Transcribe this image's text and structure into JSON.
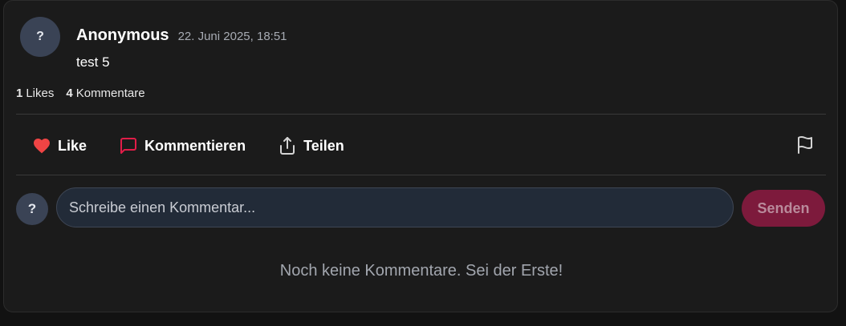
{
  "post": {
    "avatar_initial": "?",
    "author": "Anonymous",
    "timestamp": "22. Juni 2025, 18:51",
    "text": "test 5"
  },
  "stats": {
    "likes_count": "1",
    "likes_label": "Likes",
    "comments_count": "4",
    "comments_label": "Kommentare"
  },
  "actions": {
    "like_label": "Like",
    "comment_label": "Kommentieren",
    "share_label": "Teilen",
    "icons": [
      "heart-icon",
      "comment-icon",
      "share-icon",
      "flag-icon"
    ]
  },
  "composer": {
    "avatar_initial": "?",
    "placeholder": "Schreibe einen Kommentar...",
    "value": "",
    "send_label": "Senden"
  },
  "comments": {
    "empty_message": "Noch keine Kommentare. Sei der Erste!"
  },
  "colors": {
    "background": "#121212",
    "card": "#1b1b1b",
    "accent": "#e11d48",
    "heart": "#ef4444",
    "send_button_disabled": "#7d1a3c",
    "avatar": "#3a4355",
    "input_background": "#222b38"
  }
}
